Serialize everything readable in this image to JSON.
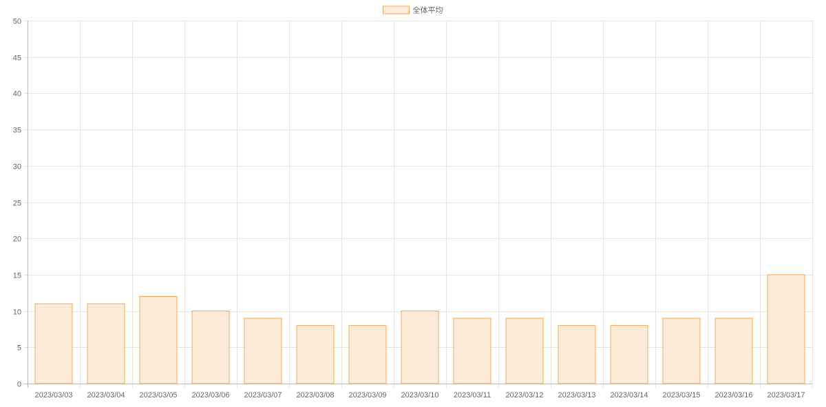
{
  "chart_data": {
    "type": "bar",
    "categories": [
      "2023/03/03",
      "2023/03/04",
      "2023/03/05",
      "2023/03/06",
      "2023/03/07",
      "2023/03/08",
      "2023/03/09",
      "2023/03/10",
      "2023/03/11",
      "2023/03/12",
      "2023/03/13",
      "2023/03/14",
      "2023/03/15",
      "2023/03/16",
      "2023/03/17"
    ],
    "series": [
      {
        "name": "全体平均",
        "values": [
          11,
          11,
          12,
          10,
          9,
          8,
          8,
          10,
          9,
          9,
          8,
          8,
          9,
          9,
          15
        ]
      }
    ],
    "title": "",
    "xlabel": "",
    "ylabel": "",
    "ylim": [
      0,
      50
    ],
    "yticks": [
      0,
      5,
      10,
      15,
      20,
      25,
      30,
      35,
      40,
      45,
      50
    ],
    "grid": true,
    "legend_position": "top-center",
    "colors": {
      "bar_fill": "#fdebd7",
      "bar_stroke": "#f5a451",
      "grid": "#e5e5e5",
      "axis": "#bbbbbb",
      "text": "#666666"
    }
  }
}
